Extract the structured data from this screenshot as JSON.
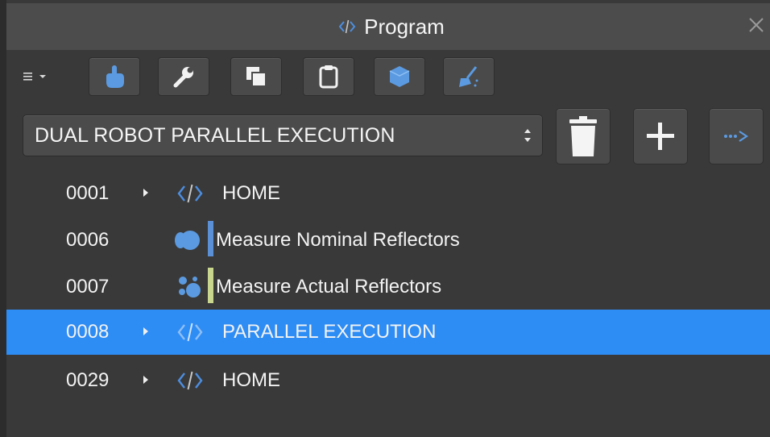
{
  "window": {
    "title": "Program",
    "close_glyph": "✕"
  },
  "toolbar": {
    "menu_icon": "list-menu-icon",
    "buttons": [
      {
        "name": "touch-tool-button",
        "icon": "hand-pointer-icon"
      },
      {
        "name": "settings-tool-button",
        "icon": "wrench-icon"
      },
      {
        "name": "copy-tool-button",
        "icon": "copy-icon"
      },
      {
        "name": "paste-tool-button",
        "icon": "clipboard-icon"
      },
      {
        "name": "object-tool-button",
        "icon": "cube-icon"
      },
      {
        "name": "clean-tool-button",
        "icon": "broom-icon"
      }
    ]
  },
  "program": {
    "selected": "DUAL ROBOT PARALLEL EXECUTION",
    "actions": [
      "delete-icon",
      "add-icon",
      "run-sequence-icon"
    ]
  },
  "tree": [
    {
      "num": "0001",
      "label": "HOME",
      "type": "code",
      "expandable": true,
      "selected": false
    },
    {
      "num": "0006",
      "label": "Measure Nominal Reflectors",
      "type": "measure-nominal",
      "expandable": false,
      "selected": false,
      "bar_color": "#5b8fd6"
    },
    {
      "num": "0007",
      "label": "Measure Actual Reflectors",
      "type": "measure-actual",
      "expandable": false,
      "selected": false,
      "bar_color": "#c9d68e"
    },
    {
      "num": "0008",
      "label": "PARALLEL EXECUTION",
      "type": "code",
      "expandable": true,
      "selected": true
    },
    {
      "num": "0029",
      "label": "HOME",
      "type": "code",
      "expandable": true,
      "selected": false
    }
  ],
  "colors": {
    "accent_blue": "#5b9ae0",
    "selection": "#2e8cf5",
    "panel": "#393939",
    "titlebar": "#4c4c4c"
  }
}
